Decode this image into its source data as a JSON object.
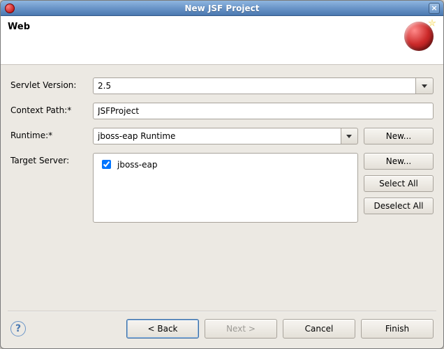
{
  "window": {
    "title": "New JSF Project"
  },
  "header": {
    "title": "Web"
  },
  "labels": {
    "servletVersion": "Servlet Version:",
    "contextPath": "Context Path:*",
    "runtime": "Runtime:*",
    "targetServer": "Target Server:"
  },
  "fields": {
    "servletVersion": "2.5",
    "contextPath": "JSFProject",
    "runtime": "jboss-eap Runtime"
  },
  "targetServers": [
    {
      "name": "jboss-eap",
      "checked": true
    }
  ],
  "buttons": {
    "runtimeNew": "New...",
    "targetNew": "New...",
    "selectAll": "Select All",
    "deselectAll": "Deselect All",
    "back": "< Back",
    "next": "Next >",
    "cancel": "Cancel",
    "finish": "Finish"
  },
  "wizard": {
    "nextEnabled": false
  }
}
